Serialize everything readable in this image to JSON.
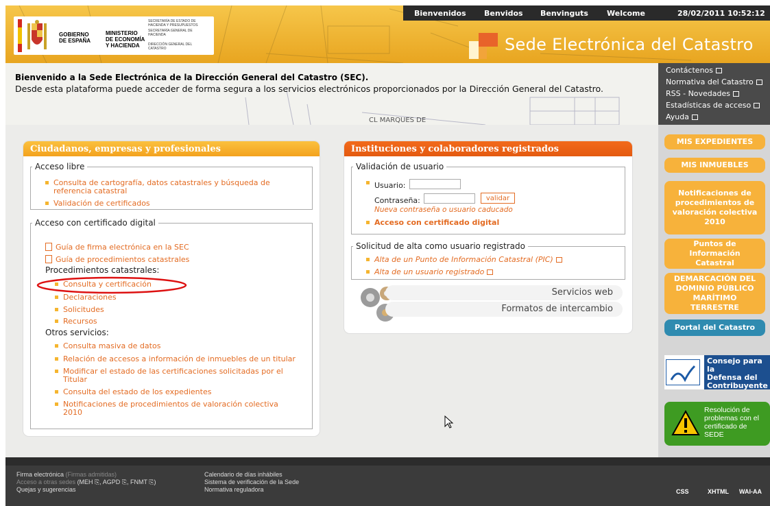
{
  "header": {
    "gov_logo": {
      "line1": "GOBIERNO",
      "line2": "DE ESPAÑA",
      "ministry1": "MINISTERIO",
      "ministry2": "DE ECONOMÍA",
      "ministry3": "Y HACIENDA",
      "sec1": "SECRETARÍA DE ESTADO DE HACIENDA Y PRESUPUESTOS",
      "sec2": "SECRETARÍA GENERAL DE HACIENDA",
      "sec3": "DIRECCIÓN GENERAL DEL CATASTRO"
    },
    "topnav": [
      "Bienvenidos",
      "Benvidos",
      "Benvinguts",
      "Welcome"
    ],
    "datetime": "28/02/2011 10:52:12",
    "title": "Sede Electrónica del Catastro"
  },
  "welcome": {
    "title": "Bienvenido a la Sede Electrónica de la Dirección General del Catastro (SEC).",
    "text": "Desde esta plataforma puede acceder de forma segura a los servicios electrónicos proporcionados por la Dirección General del Catastro."
  },
  "right_links": [
    "Contáctenos",
    "Normativa del Catastro",
    "RSS - Novedades",
    "Estadísticas de acceso",
    "Ayuda"
  ],
  "ciudadanos": {
    "title": "Ciudadanos, empresas y profesionales",
    "libre_legend": "Acceso libre",
    "libre_links": [
      "Consulta de cartografía, datos catastrales y búsqueda de",
      "referencia catastral",
      "Validación de certificados"
    ],
    "cert_legend": "Acceso con certificado digital",
    "guia1": "Guía de firma electrónica en la SEC",
    "guia2": "Guía de procedimientos catastrales",
    "proc_label": "Procedimientos catastrales:",
    "proc_links": [
      "Consulta y certificación",
      "Declaraciones",
      "Solicitudes",
      "Recursos"
    ],
    "otros_label": "Otros servicios:",
    "otros_links": [
      "Consulta masiva de datos",
      "Relación de accesos a información de inmuebles de un titular",
      "Modificar el estado de las certificaciones solicitadas por el",
      "Titular",
      "Consulta del estado de los expedientes",
      "Notificaciones de procedimientos de valoración colectiva",
      "2010"
    ]
  },
  "instituciones": {
    "title": "Instituciones y colaboradores registrados",
    "valid_legend": "Validación de usuario",
    "usuario_label": "Usuario:",
    "usuario_value": "",
    "contrasena_label": "Contraseña:",
    "contrasena_value": "",
    "validar": "validar",
    "caducado": "Nueva contraseña o usuario caducado",
    "acceso_cert": "Acceso con certificado digital",
    "alta_legend": "Solicitud de alta como usuario registrado",
    "alta_links": [
      "Alta de un Punto de Información Catastral (PIC)",
      "Alta de un usuario registrado"
    ],
    "servicios_web": "Servicios web",
    "formatos": "Formatos de intercambio"
  },
  "sidebar": {
    "mis_expedientes": "MIS EXPEDIENTES",
    "mis_inmuebles": "MIS INMUEBLES",
    "notificaciones": [
      "Notificaciones de",
      "procedimientos de",
      "valoración colectiva",
      "2010"
    ],
    "puntos": [
      "Puntos de Información",
      "Catastral"
    ],
    "demarcacion": [
      "DEMARCACIÓN DEL",
      "DOMINIO PÚBLICO",
      "MARÍTIMO TERRESTRE"
    ],
    "portal": "Portal del Catastro",
    "consejo": [
      "Consejo para la",
      "Defensa del",
      "Contribuyente"
    ],
    "resolucion": [
      "Resolución de",
      "problemas con el",
      "certificado de",
      "SEDE"
    ],
    "colors": {
      "orange": "#f7b23b",
      "blue": "#2f8bb0",
      "green": "#3e9b22"
    }
  },
  "footer": {
    "col1": [
      {
        "text": "Firma electrónica",
        "extra": "(Firmas admitidas)"
      },
      {
        "text": "Acceso a otras sedes",
        "extra": "(MEH ⎘, AGPD ⎘, FNMT ⎘)"
      },
      {
        "text": "Quejas y sugerencias",
        "extra": ""
      }
    ],
    "col2": [
      "Calendario de días inhábiles",
      "Sistema de verificación de la Sede",
      "Normativa reguladora"
    ],
    "badges": [
      "CSS",
      "XHTML",
      "WAI-AA"
    ]
  }
}
